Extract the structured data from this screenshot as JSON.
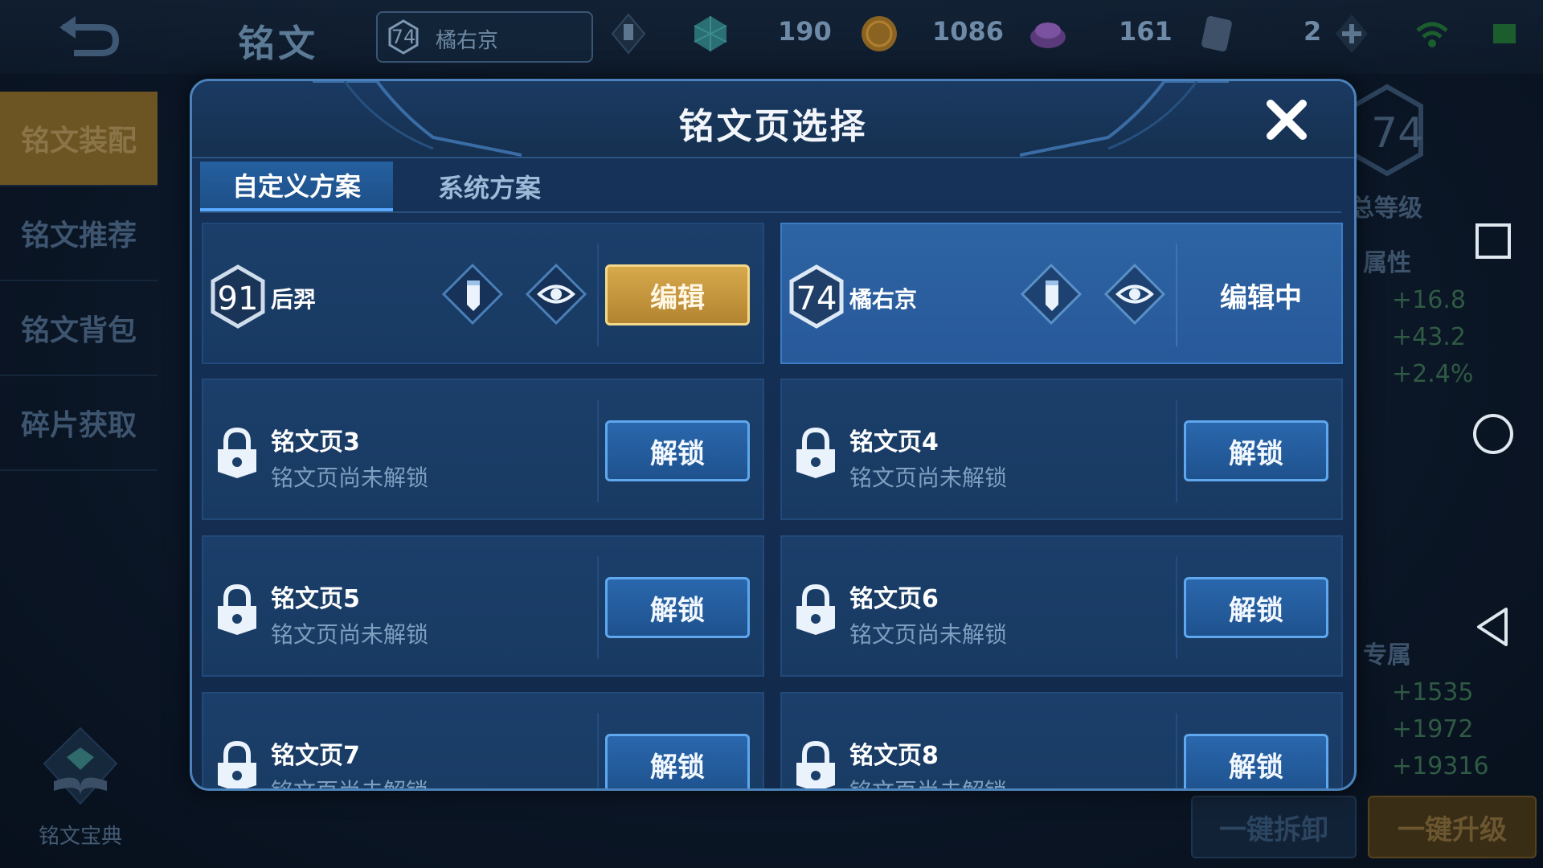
{
  "topbar": {
    "title": "铭文",
    "current_page": {
      "level": "74",
      "name": "橘右京"
    },
    "resources": [
      {
        "icon": "gem-icon",
        "value": "190"
      },
      {
        "icon": "gold-coin-icon",
        "value": "1086"
      },
      {
        "icon": "crystal-icon",
        "value": "161"
      },
      {
        "icon": "card-icon",
        "value": "2"
      }
    ]
  },
  "leftnav": {
    "items": [
      {
        "label": "铭文装配"
      },
      {
        "label": "铭文推荐"
      },
      {
        "label": "铭文背包"
      },
      {
        "label": "碎片获取"
      }
    ],
    "codex_label": "铭文宝典"
  },
  "right_panel": {
    "level": "74",
    "total_level_label": "总等级",
    "attr_label": "属性",
    "stats_a": [
      "+16.8",
      "+43.2",
      "+2.4%"
    ],
    "exclusive_label": "专属",
    "stats_b": [
      "+1535",
      "+1972",
      "+19316"
    ],
    "btn_disassemble": "一键拆卸",
    "btn_upgrade": "一键升级"
  },
  "modal": {
    "title": "铭文页选择",
    "tabs": [
      {
        "label": "自定义方案"
      },
      {
        "label": "系统方案"
      }
    ],
    "pages": [
      {
        "level": "91",
        "name": "后羿",
        "action": "编辑"
      },
      {
        "level": "74",
        "name": "橘右京",
        "action": "编辑中"
      }
    ],
    "locked": [
      {
        "name": "铭文页3",
        "status": "铭文页尚未解锁",
        "action": "解锁"
      },
      {
        "name": "铭文页4",
        "status": "铭文页尚未解锁",
        "action": "解锁"
      },
      {
        "name": "铭文页5",
        "status": "铭文页尚未解锁",
        "action": "解锁"
      },
      {
        "name": "铭文页6",
        "status": "铭文页尚未解锁",
        "action": "解锁"
      },
      {
        "name": "铭文页7",
        "status": "铭文页尚未解锁",
        "action": "解锁"
      },
      {
        "name": "铭文页8",
        "status": "铭文页尚未解锁",
        "action": "解锁"
      }
    ]
  },
  "colors": {
    "accent_gold": "#d7a94c",
    "accent_blue": "#2a67ad",
    "modal_bg": "#16335a"
  }
}
